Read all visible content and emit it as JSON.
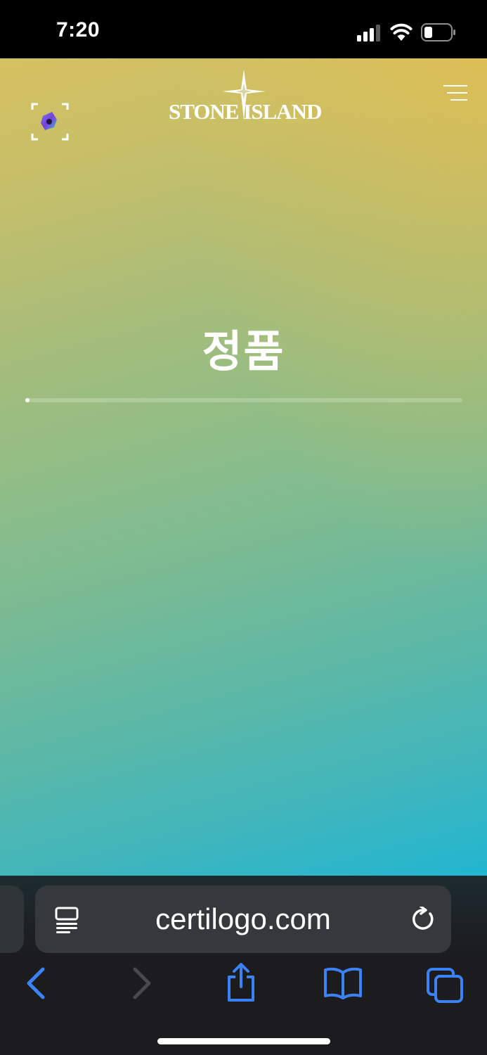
{
  "status_bar": {
    "time": "7:20",
    "icons": [
      "signal-icon",
      "wifi-icon",
      "battery-icon"
    ]
  },
  "page": {
    "brand": "STONE ISLAND",
    "headline": "정품",
    "progress": 0.01,
    "icons": [
      "scan-icon",
      "compass-rose-icon",
      "menu-icon"
    ],
    "colors": {
      "gradient_top": "#d5c160",
      "gradient_corner": "#e6c152",
      "gradient_bottom": "#21b6d1",
      "text": "#ffffff"
    }
  },
  "browser": {
    "url": "certilogo.com",
    "icons": [
      "reader-icon",
      "reload-icon",
      "back-icon",
      "forward-icon",
      "share-icon",
      "bookmarks-icon",
      "tabs-icon"
    ],
    "accent": "#3b82f6"
  }
}
